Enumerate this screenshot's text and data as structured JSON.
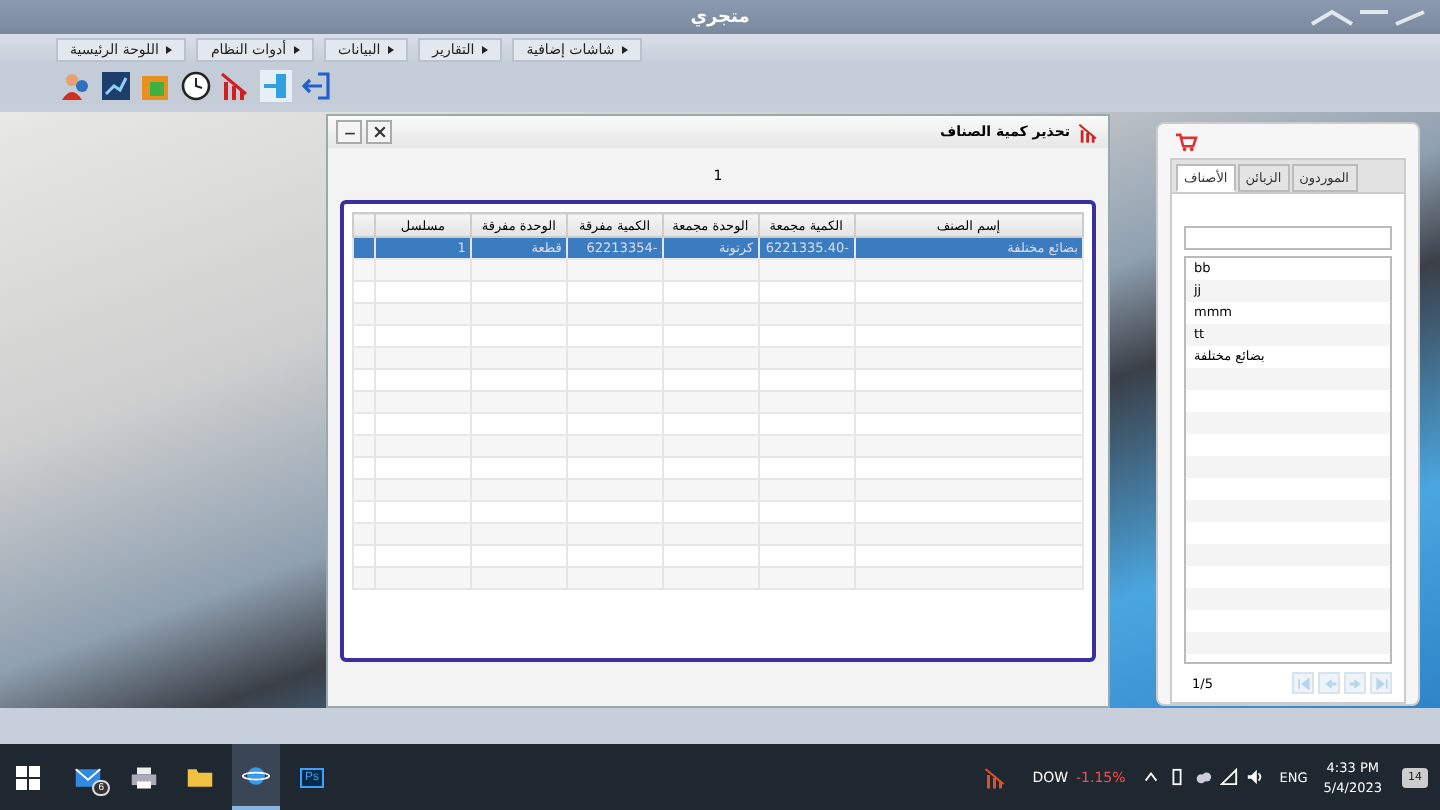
{
  "window": {
    "title": "متجري"
  },
  "menu": [
    {
      "label": "شاشات إضافية"
    },
    {
      "label": "التقارير"
    },
    {
      "label": "البيانات"
    },
    {
      "label": "أدوات النظام"
    },
    {
      "label": "اللوحة الرئيسية"
    }
  ],
  "dialog": {
    "title": "تحذير كمية الصناف",
    "count": "1",
    "table": {
      "columns": [
        "إسم الصنف",
        "الكمية مجمعة",
        "الوحدة مجمعة",
        "الكمية مفرقة",
        "الوحدة مفرقة",
        "مسلسل"
      ],
      "rows": [
        {
          "cells": [
            "بضائع مختلفة",
            "-6221335.40",
            "كرتونة",
            "-62213354",
            "قطعة",
            "1"
          ],
          "selected": true
        }
      ]
    }
  },
  "side_panel": {
    "tabs": [
      {
        "label": "الموردون",
        "selected": false
      },
      {
        "label": "الزبائن",
        "selected": false
      },
      {
        "label": "الأصناف",
        "selected": true
      }
    ],
    "items": [
      "bb",
      "jj",
      "mmm",
      "tt",
      "بضائع مختلفة"
    ],
    "pager": "1/5"
  },
  "taskbar": {
    "apps": [
      {
        "kind": "mail",
        "badge": "6",
        "selected": false
      },
      {
        "kind": "printer",
        "selected": false
      },
      {
        "kind": "folder",
        "selected": false
      },
      {
        "kind": "browser",
        "selected": true
      },
      {
        "kind": "photoshop",
        "label": "Ps",
        "selected": false
      }
    ],
    "ticker": {
      "symbol": "DOW",
      "change": "-1.15%"
    },
    "language": "ENG",
    "time": "4:33 PM",
    "date": "5/4/2023",
    "notifications": "14"
  }
}
